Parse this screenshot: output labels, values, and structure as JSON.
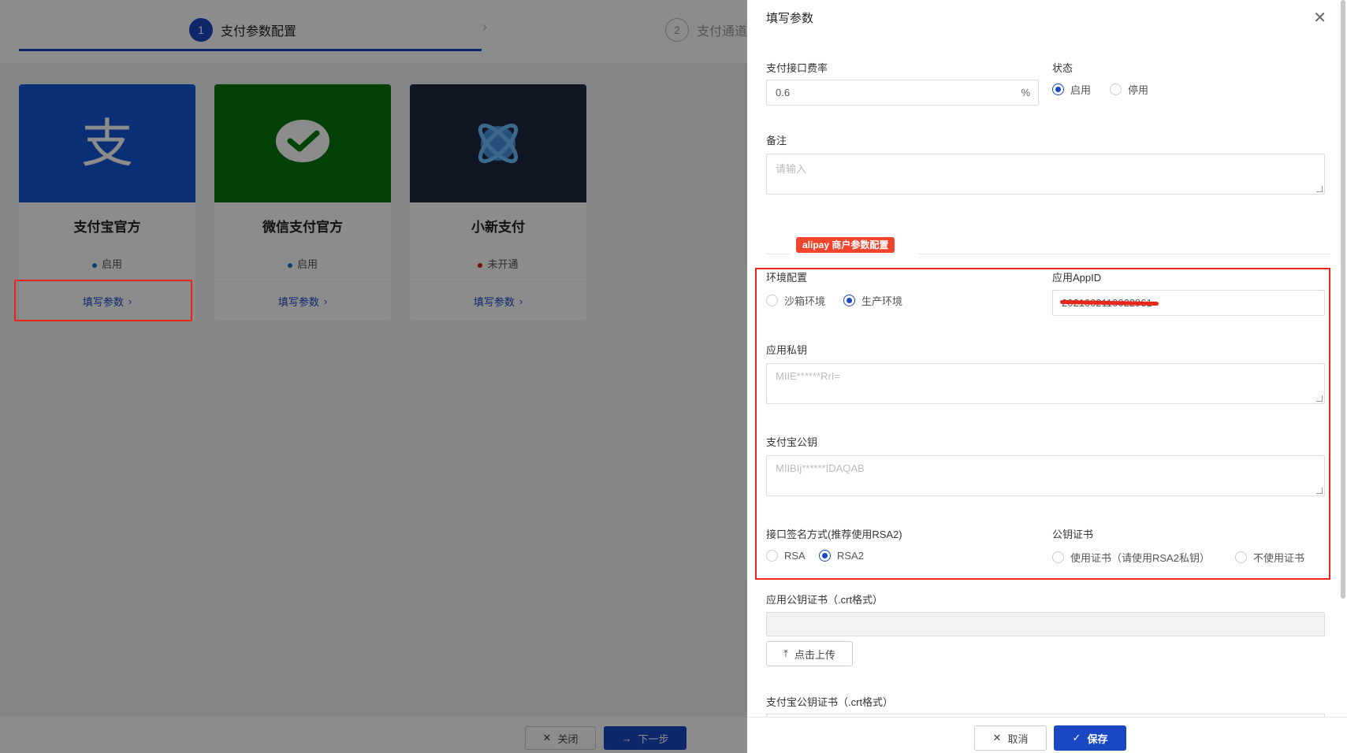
{
  "steps": [
    {
      "num": "1",
      "label": "支付参数配置"
    },
    {
      "num": "2",
      "label": "支付通道"
    }
  ],
  "cards": [
    {
      "name": "支付宝官方",
      "status": "启用",
      "status_color": "#1a6fd6",
      "action": "填写参数",
      "bg": "#1557d5",
      "icon": "alipay-icon"
    },
    {
      "name": "微信支付官方",
      "status": "启用",
      "status_color": "#1a6fd6",
      "action": "填写参数",
      "bg": "#05790d",
      "icon": "wechat-pay-icon"
    },
    {
      "name": "小新支付",
      "status": "未开通",
      "status_color": "#d81e1e",
      "action": "填写参数",
      "bg": "#1f2b3f",
      "icon": "xiaoxin-pay-icon"
    }
  ],
  "bg_footer": {
    "close": "关闭",
    "next": "下一步"
  },
  "drawer": {
    "title": "填写参数",
    "fee_rate": {
      "label": "支付接口费率",
      "value": "0.6",
      "suffix": "%"
    },
    "status": {
      "label": "状态",
      "options": [
        "启用",
        "停用"
      ],
      "selected": "启用"
    },
    "remark": {
      "label": "备注",
      "placeholder": "请输入"
    },
    "section_tag": "alipay 商户参数配置",
    "env": {
      "label": "环境配置",
      "options": [
        "沙箱环境",
        "生产环境"
      ],
      "selected": "生产环境"
    },
    "app_id": {
      "label": "应用AppID",
      "value": "2021002110022961"
    },
    "private_key": {
      "label": "应用私钥",
      "placeholder": "MIIE******RrI="
    },
    "alipay_public_key": {
      "label": "支付宝公钥",
      "placeholder": "MIIBIj******IDAQAB"
    },
    "sign_type": {
      "label": "接口签名方式(推荐使用RSA2)",
      "options": [
        "RSA",
        "RSA2"
      ],
      "selected": "RSA2"
    },
    "cert": {
      "label": "公钥证书",
      "options": [
        "使用证书（请使用RSA2私钥）",
        "不使用证书"
      ],
      "selected": ""
    },
    "app_cert": {
      "label": "应用公钥证书（.crt格式）",
      "upload": "点击上传"
    },
    "alipay_cert": {
      "label": "支付宝公钥证书（.crt格式）"
    },
    "footer": {
      "cancel": "取消",
      "save": "保存"
    }
  },
  "colors": {
    "primary": "#1a48c4",
    "highlight": "#e8271c",
    "tag": "#f0442c"
  }
}
